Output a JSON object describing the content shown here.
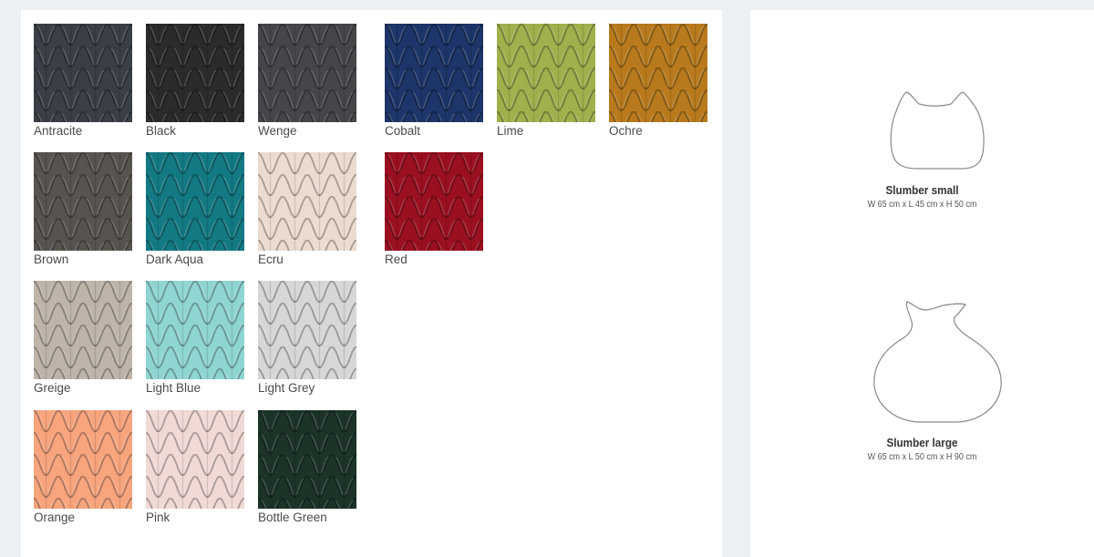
{
  "swatches": [
    {
      "label": "Antracite",
      "color": "#3a3e45",
      "col": 0,
      "row": 0
    },
    {
      "label": "Black",
      "color": "#2a2c2c",
      "col": 1,
      "row": 0
    },
    {
      "label": "Wenge",
      "color": "#47444a",
      "col": 2,
      "row": 0
    },
    {
      "label": "Cobalt",
      "color": "#1d3568",
      "col": 3,
      "row": 0
    },
    {
      "label": "Lime",
      "color": "#9fb04c",
      "col": 4,
      "row": 0
    },
    {
      "label": "Ochre",
      "color": "#b87a1c",
      "col": 5,
      "row": 0
    },
    {
      "label": "Brown",
      "color": "#57534f",
      "col": 0,
      "row": 1
    },
    {
      "label": "Dark Aqua",
      "color": "#137983",
      "col": 1,
      "row": 1
    },
    {
      "label": "Ecru",
      "color": "#ecdcd0",
      "col": 2,
      "row": 1
    },
    {
      "label": "Red",
      "color": "#9a1020",
      "col": 3,
      "row": 1
    },
    {
      "label": "Greige",
      "color": "#beb4a9",
      "col": 0,
      "row": 2
    },
    {
      "label": "Light Blue",
      "color": "#8fd5d2",
      "col": 1,
      "row": 2
    },
    {
      "label": "Light Grey",
      "color": "#d5d7d9",
      "col": 2,
      "row": 2
    },
    {
      "label": "Orange",
      "color": "#f8a57e",
      "col": 0,
      "row": 3
    },
    {
      "label": "Pink",
      "color": "#f1d9d6",
      "col": 1,
      "row": 3
    },
    {
      "label": "Bottle Green",
      "color": "#1c3328",
      "col": 2,
      "row": 3
    }
  ],
  "products": [
    {
      "name": "Slumber small",
      "dims": "W 65 cm x L 45 cm x H 50 cm",
      "icon": "slumber-small-outline-icon"
    },
    {
      "name": "Slumber large",
      "dims": "W 65 cm x L 50 cm x H 90 cm",
      "icon": "slumber-large-outline-icon"
    }
  ]
}
